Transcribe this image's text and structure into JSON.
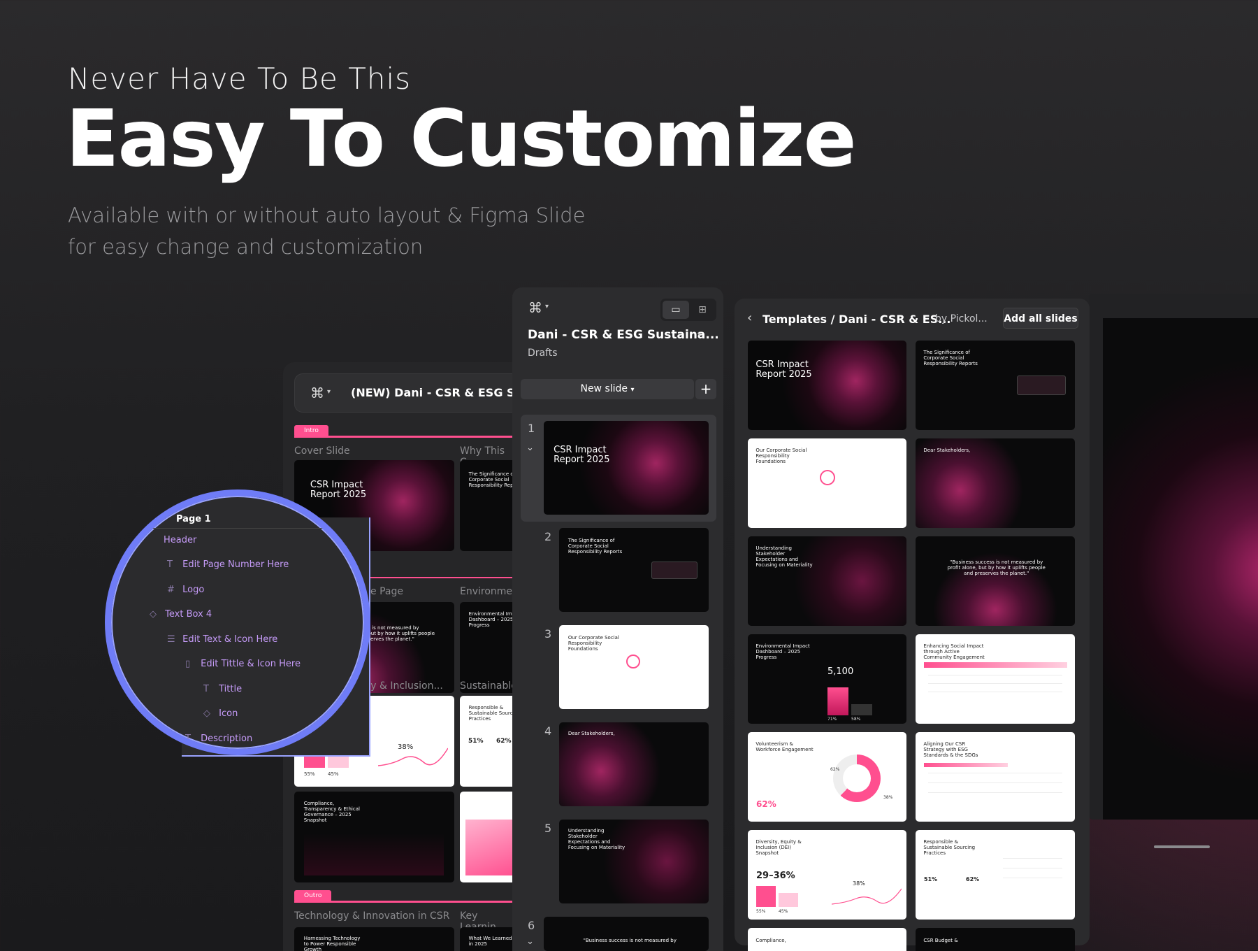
{
  "hero": {
    "eyebrow": "Never Have To Be This",
    "title": "Easy To Customize",
    "subtitle_line1": "Available with or without auto layout  & Figma Slide",
    "subtitle_line2": "for easy change and customization"
  },
  "left_panel": {
    "file_title": "(NEW) Dani - CSR & ESG Susta",
    "intro_tag": "Intro",
    "outro_tag": "Outro",
    "sections": {
      "cover": "Cover Slide",
      "why": "Why This C",
      "page": "e Page",
      "environment": "Environmen",
      "equity": "uity & Inclusion...",
      "sustainable": "Sustainable",
      "tech": "Technology & Innovation in CSR",
      "key": "Key Learnin"
    },
    "thumbs": {
      "cover_title": "CSR Impact\nReport 2025",
      "why_title": "The Significance of\nCorporate Social\nResponsibility Repo",
      "quote": "s is not measured by\nbut by how it uplifts people\nserves the planet.\"",
      "env_title": "Environmental Impa\nDashboard – 2025\nProgress",
      "resp_title": "Responsible &\nSustainable Sourci\nPractices",
      "stat_38": "38%",
      "stat_55": "55%",
      "stat_45": "45%",
      "stat_51": "51%",
      "stat_62": "62%",
      "compliance": "Compliance,\nTransparency & Ethical\nGovernance – 2025\nSnapshot",
      "resp2": "Responsible &\nSustainable Sourci\nPractices",
      "harness": "Harnessing Technology\nto Power Responsible\nGrowth",
      "learned": "What We Learned\nin 2025"
    }
  },
  "layers": {
    "page": "Page 1",
    "header": "Header",
    "items": [
      {
        "icon": "T",
        "label": "Edit Page Number Here"
      },
      {
        "icon": "#",
        "label": "Logo"
      },
      {
        "icon": "◇",
        "label": "Text Box 4"
      },
      {
        "icon": "☰",
        "label": "Edit Text & Icon Here"
      },
      {
        "icon": "▯",
        "label": "Edit Tittle & Icon Here"
      },
      {
        "icon": "T",
        "label": "Tittle"
      },
      {
        "icon": "◇",
        "label": "Icon"
      },
      {
        "icon": "T",
        "label": "Description"
      }
    ]
  },
  "slides_panel": {
    "file_title": "Dani - CSR & ESG Sustaina...",
    "location": "Drafts",
    "new_slide": "New slide",
    "numbers": [
      "1",
      "2",
      "3",
      "4",
      "5",
      "6"
    ],
    "thumbs": {
      "s1": "CSR Impact\nReport 2025",
      "s2": "The Significance of\nCorporate Social\nResponsibility Reports",
      "s3": "Our Corporate Social\nResponsibility\nFoundations",
      "s4": "Dear Stakeholders,",
      "s5": "Understanding\nStakeholder\nExpectations and\nFocusing on Materiality",
      "s6": "\"Business success is not measured by"
    }
  },
  "templates_panel": {
    "breadcrumb": "Templates / Dani - CSR & ES...",
    "author": "by Pickol...",
    "add_all": "Add all slides",
    "thumbs": {
      "t1": "CSR Impact\nReport 2025",
      "t2": "The Significance of\nCorporate Social\nResponsibility Reports",
      "t3": "Our Corporate Social\nResponsibility\nFoundations",
      "t4": "Dear Stakeholders,",
      "t5": "Understanding\nStakeholder\nExpectations and\nFocusing on Materiality",
      "t6": "\"Business success is not measured by\nprofit alone, but by how it uplifts people\nand preserves the planet.\"",
      "t7": "Environmental Impact\nDashboard – 2025\nProgress",
      "t7_value": "5,100",
      "t7_a": "71%",
      "t7_b": "58%",
      "t8": "Enhancing Social Impact\nthrough Active\nCommunity Engagement",
      "t9": "Volunteerism &\nWorkforce Engagement",
      "t9_value": "62%",
      "t9_ring": "62%",
      "t9_ring2": "38%",
      "t10": "Aligning Our CSR\nStrategy with ESG\nStandards & the SDGs",
      "t11": "Diversity, Equity &\nInclusion (DEI)\nSnapshot",
      "t11_value": "29–36%",
      "t11_pct": "38%",
      "t11_a": "55%",
      "t11_b": "45%",
      "t12": "Responsible &\nSustainable Sourcing\nPractices",
      "t12_a": "51%",
      "t12_b": "62%",
      "t13": "Compliance,",
      "t14": "CSR Budget &"
    }
  },
  "colors": {
    "accent": "#ff4f8f",
    "ring": "#6f7cf7",
    "layer_text": "#c59bf8"
  }
}
